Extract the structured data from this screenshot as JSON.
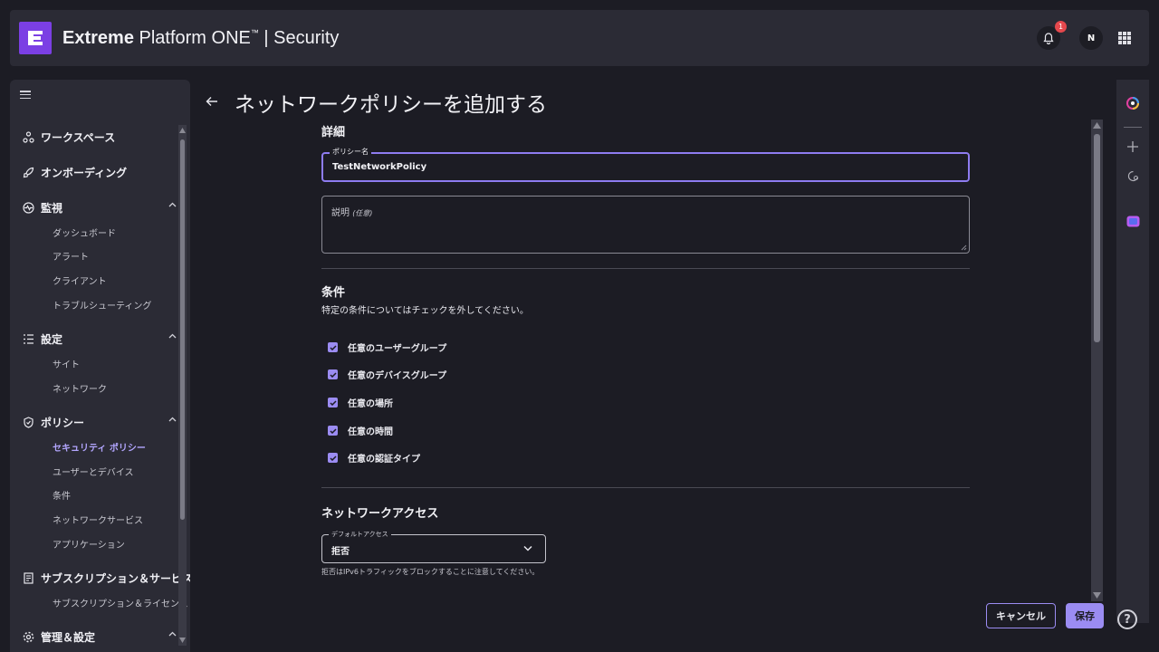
{
  "header": {
    "brand": "Extreme",
    "product": "Platform ONE",
    "trademark": "™",
    "section": "| Security",
    "notifications_count": "1",
    "avatar_initial": "N"
  },
  "sidebar": {
    "sections": [
      {
        "label": "ワークスペース",
        "icon": "workspace-icon"
      },
      {
        "label": "オンボーディング",
        "icon": "rocket-icon"
      },
      {
        "label": "監視",
        "icon": "monitor-icon",
        "items": [
          "ダッシュボード",
          "アラート",
          "クライアント",
          "トラブルシューティング"
        ]
      },
      {
        "label": "設定",
        "icon": "settings-list-icon",
        "items": [
          "サイト",
          "ネットワーク"
        ]
      },
      {
        "label": "ポリシー",
        "icon": "shield-icon",
        "items": [
          "セキュリティ ポリシー",
          "ユーザーとデバイス",
          "条件",
          "ネットワークサービス",
          "アプリケーション"
        ]
      },
      {
        "label": "サブスクリプション＆サービス",
        "icon": "document-icon",
        "items": [
          "サブスクリプション＆ライセンス"
        ]
      },
      {
        "label": "管理＆設定",
        "icon": "gear-icon"
      }
    ],
    "active_item": "セキュリティ ポリシー"
  },
  "page": {
    "title": "ネットワークポリシーを追加する",
    "details_heading": "詳細",
    "policy_name_label": "ポリシー名",
    "policy_name_value": "TestNetworkPolicy",
    "description_label": "説明",
    "description_optional": "(任意)",
    "conditions_heading": "条件",
    "conditions_subtitle": "特定の条件についてはチェックを外してください。",
    "conditions": [
      {
        "label": "任意のユーザーグループ",
        "checked": true
      },
      {
        "label": "任意のデバイスグループ",
        "checked": true
      },
      {
        "label": "任意の場所",
        "checked": true
      },
      {
        "label": "任意の時間",
        "checked": true
      },
      {
        "label": "任意の認証タイプ",
        "checked": true
      }
    ],
    "network_access_heading": "ネットワークアクセス",
    "default_access_label": "デフォルトアクセス",
    "default_access_value": "拒否",
    "default_access_helper": "拒否はIPv6トラフィックをブロックすることに注意してください。"
  },
  "actions": {
    "cancel": "キャンセル",
    "save": "保存"
  },
  "help": "?",
  "colors": {
    "accent": "#9b8cf2",
    "brand": "#7b3fe4",
    "panel": "#2b2b35",
    "background": "#1c1c24"
  }
}
